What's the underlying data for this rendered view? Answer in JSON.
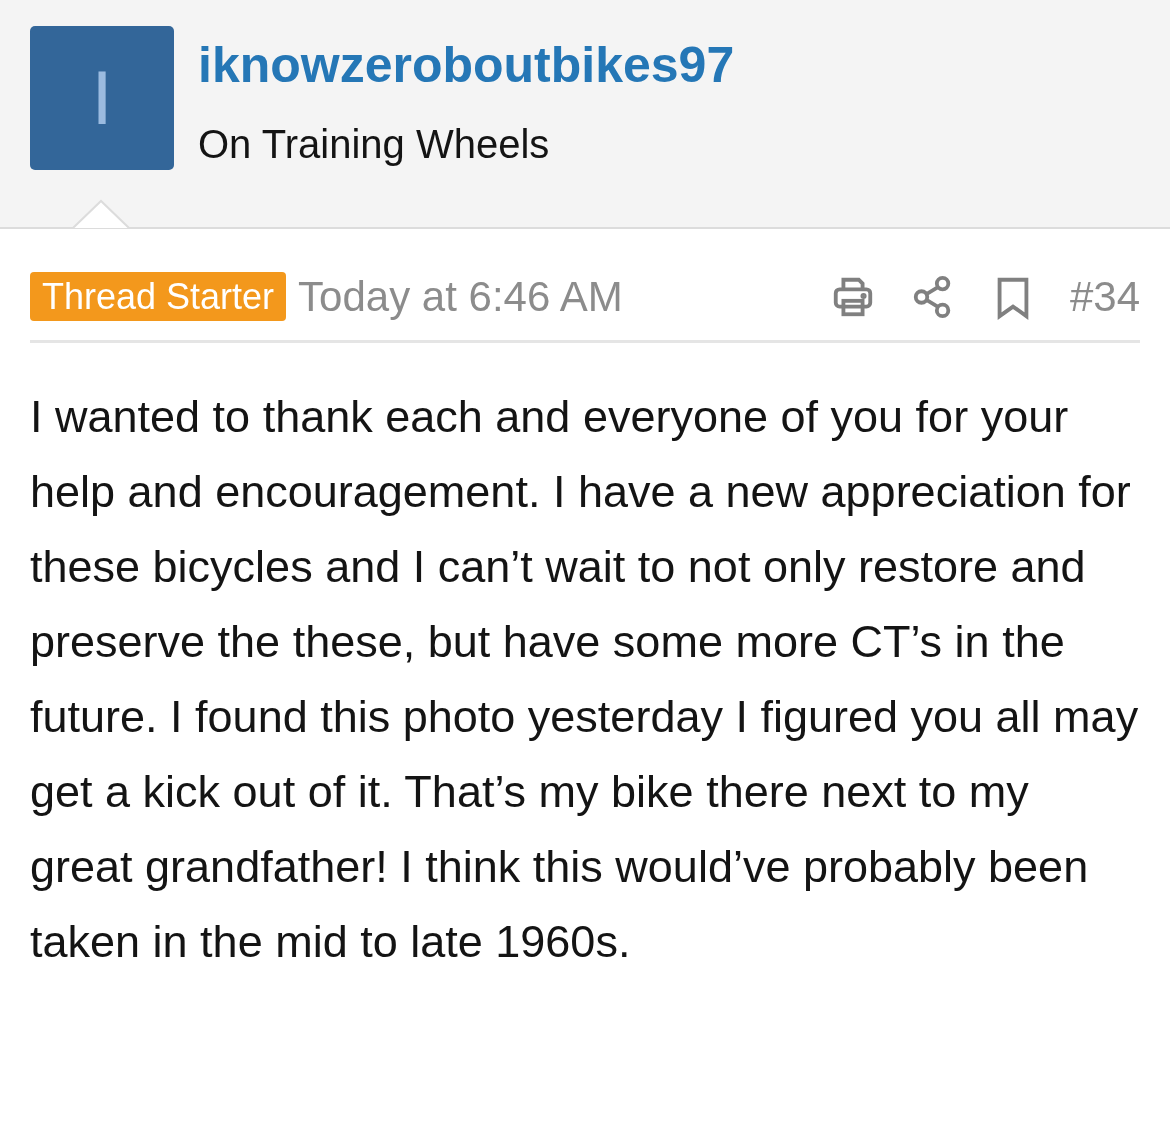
{
  "author": {
    "avatar_letter": "I",
    "username": "iknowzeroboutbikes97",
    "title": "On Training Wheels"
  },
  "post": {
    "badge": "Thread Starter",
    "time": "Today at 6:46 AM",
    "number": "#34",
    "body": "I wanted to thank each and everyone of you for your help and encouragement. I have a new appreciation for these bicycles and I can’t wait to not only restore and preserve the these, but have some more CT’s in the future. I found this photo yesterday I figured you all may get a kick out of it. That’s my bike there next to my great grandfather! I think this would’ve probably been taken in the mid to late 1960s."
  }
}
